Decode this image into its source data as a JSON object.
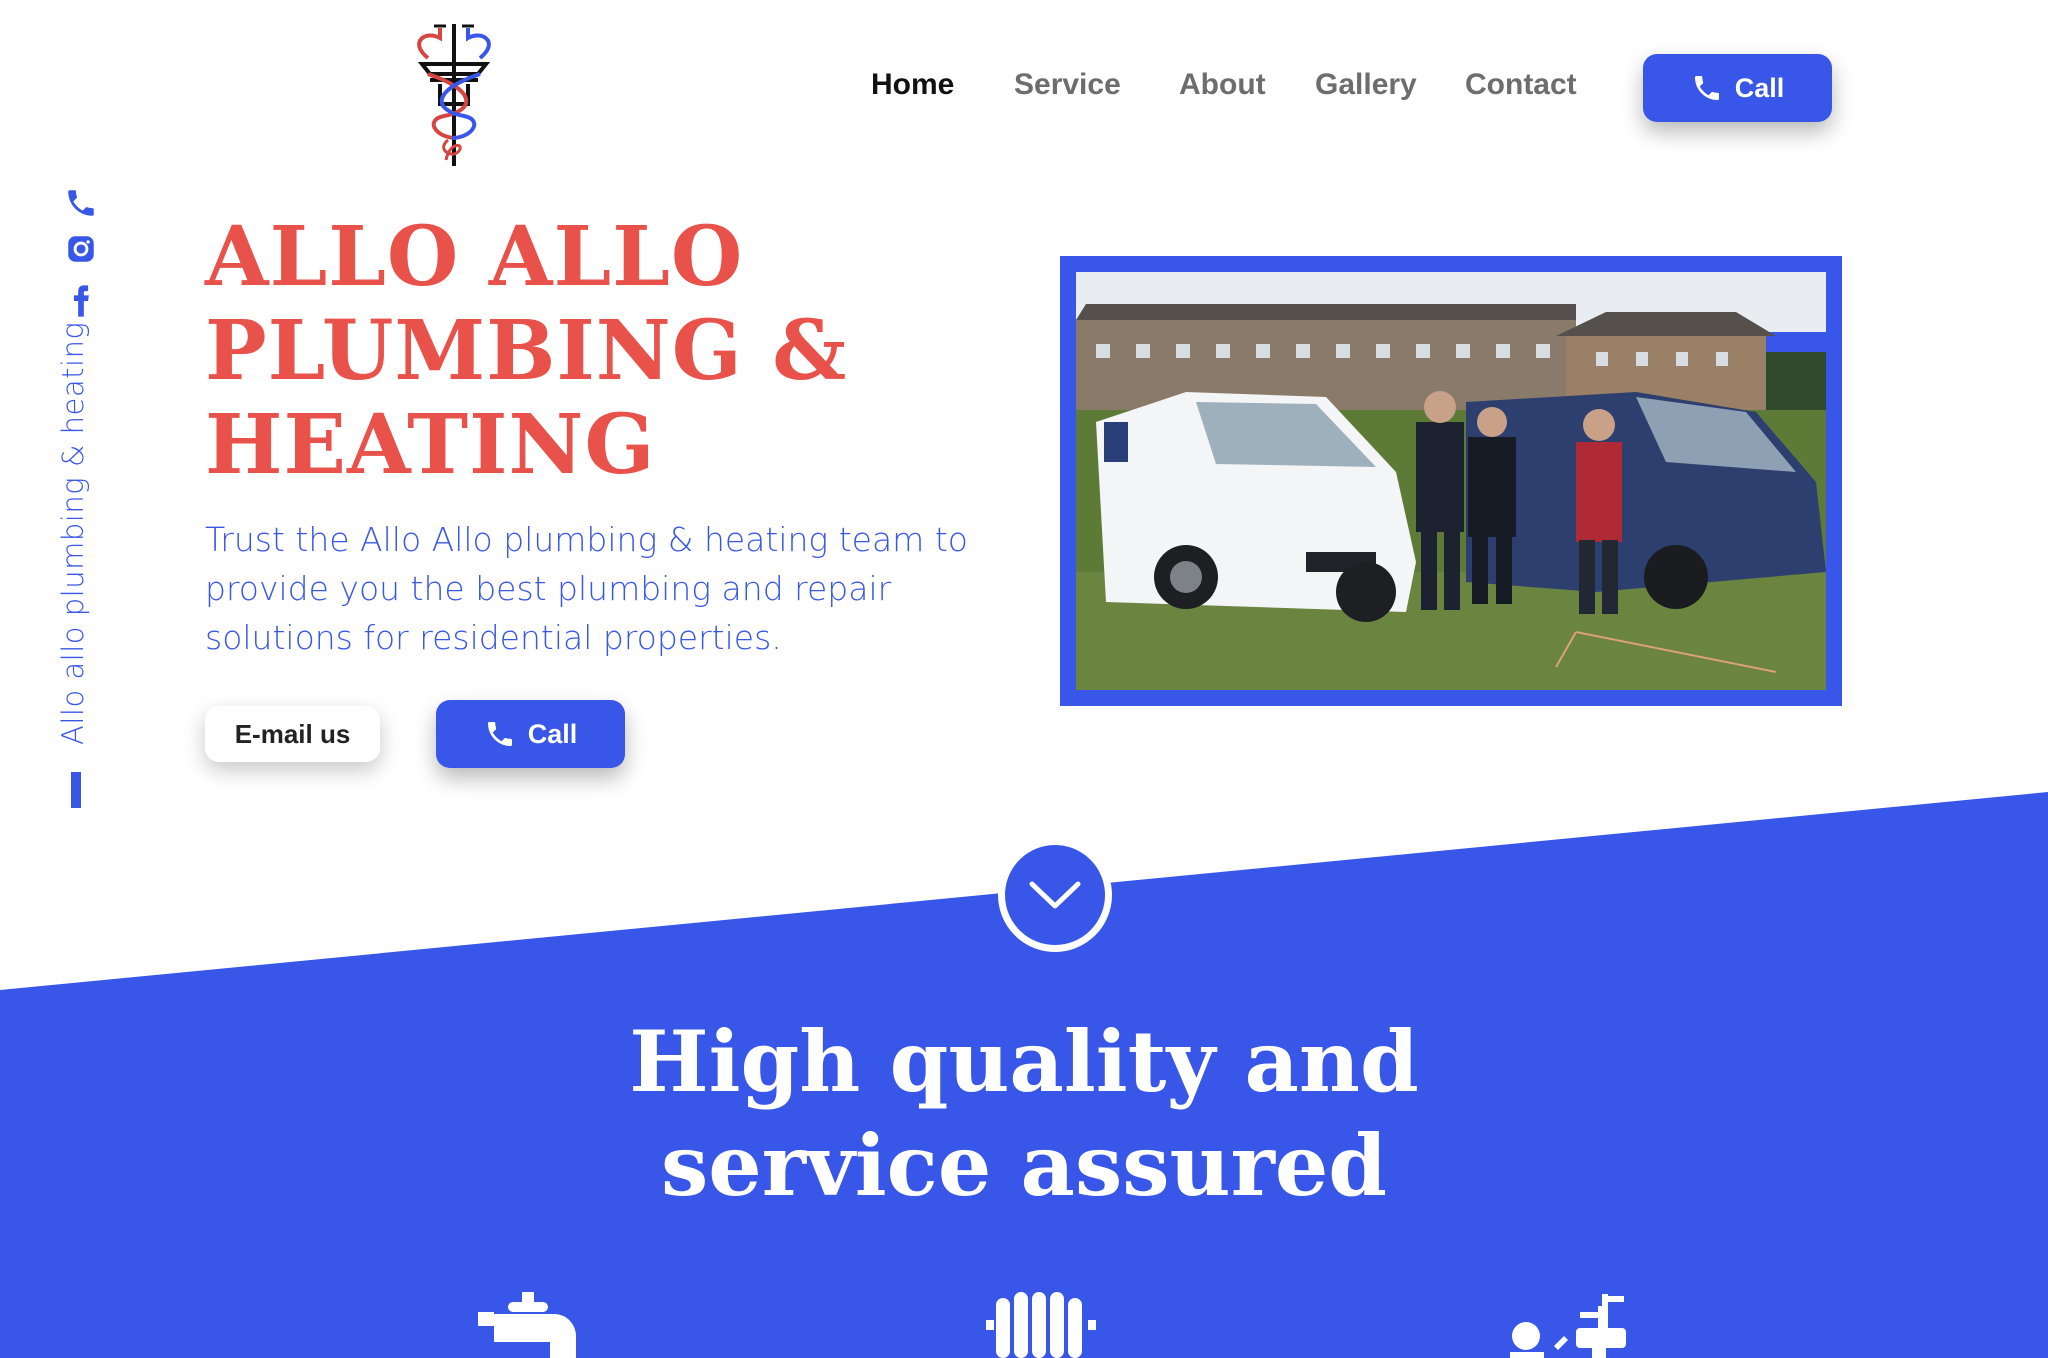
{
  "nav": {
    "items": [
      {
        "label": "Home",
        "active": true
      },
      {
        "label": "Service",
        "active": false
      },
      {
        "label": "About",
        "active": false
      },
      {
        "label": "Gallery",
        "active": false
      },
      {
        "label": "Contact",
        "active": false
      }
    ],
    "call_label": "Call"
  },
  "side": {
    "text": "Allo allo plumbing & heating",
    "icons": [
      "phone-icon",
      "instagram-icon",
      "facebook-icon"
    ]
  },
  "hero": {
    "title_lines": [
      "ALLO ALLO",
      "PLUMBING &",
      "HEATING"
    ],
    "text": "Trust the Allo Allo plumbing & heating team to provide you the best plumbing and repair solutions for residential properties.",
    "email_label": "E-mail us",
    "call_label": "Call"
  },
  "section": {
    "title_lines": [
      "High quality and",
      "service assured"
    ],
    "icons": [
      "tap-icon",
      "radiator-icon",
      "plumber-icon"
    ]
  },
  "colors": {
    "brand_blue": "#3856e8",
    "title_red": "#e8524a",
    "nav_gray": "#6d6d6d",
    "nav_active": "#111111"
  }
}
